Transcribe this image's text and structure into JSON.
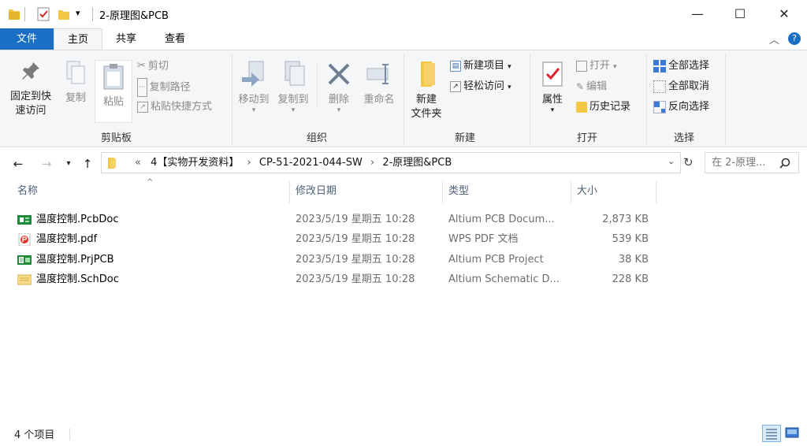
{
  "window": {
    "title": "2-原理图&PCB",
    "minimize": "—",
    "maximize": "☐",
    "close": "✕"
  },
  "tabs": {
    "file": "文件",
    "home": "主页",
    "share": "共享",
    "view": "查看"
  },
  "ribbon": {
    "clipboard": {
      "label": "剪贴板",
      "pin": "固定到快\n速访问",
      "copy": "复制",
      "paste": "粘贴",
      "cut": "剪切",
      "copy_path": "复制路径",
      "paste_shortcut": "粘贴快捷方式"
    },
    "organize": {
      "label": "组织",
      "move_to": "移动到",
      "copy_to": "复制到",
      "delete": "删除",
      "rename": "重命名"
    },
    "new": {
      "label": "新建",
      "new_folder": "新建\n文件夹",
      "new_item": "新建项目",
      "easy_access": "轻松访问"
    },
    "open": {
      "label": "打开",
      "properties": "属性",
      "open": "打开",
      "edit": "编辑",
      "history": "历史记录"
    },
    "select": {
      "label": "选择",
      "select_all": "全部选择",
      "select_none": "全部取消",
      "invert": "反向选择"
    }
  },
  "address": {
    "path": [
      "«",
      "4【实物开发资料】",
      "CP-51-2021-044-SW",
      "2-原理图&PCB"
    ],
    "search_placeholder": "在 2-原理..."
  },
  "columns": {
    "name": "名称",
    "date": "修改日期",
    "type": "类型",
    "size": "大小"
  },
  "files": [
    {
      "name": "温度控制.PcbDoc",
      "date": "2023/5/19 星期五 10:28",
      "type": "Altium PCB Docum...",
      "size": "2,873 KB",
      "icon": "pcb-icon",
      "icon_color": "#1e8b3a"
    },
    {
      "name": "温度控制.pdf",
      "date": "2023/5/19 星期五 10:28",
      "type": "WPS PDF 文档",
      "size": "539 KB",
      "icon": "pdf-icon",
      "icon_color": "#e0342e"
    },
    {
      "name": "温度控制.PrjPCB",
      "date": "2023/5/19 星期五 10:28",
      "type": "Altium PCB Project",
      "size": "38 KB",
      "icon": "prjpcb-icon",
      "icon_color": "#1e8b3a"
    },
    {
      "name": "温度控制.SchDoc",
      "date": "2023/5/19 星期五 10:28",
      "type": "Altium Schematic D...",
      "size": "228 KB",
      "icon": "schdoc-icon",
      "icon_color": "#e8c35a"
    }
  ],
  "status": {
    "count": "4 个项目"
  },
  "colors": {
    "accent": "#1a6fc4",
    "ribbon_bg": "#f5f6f7"
  }
}
